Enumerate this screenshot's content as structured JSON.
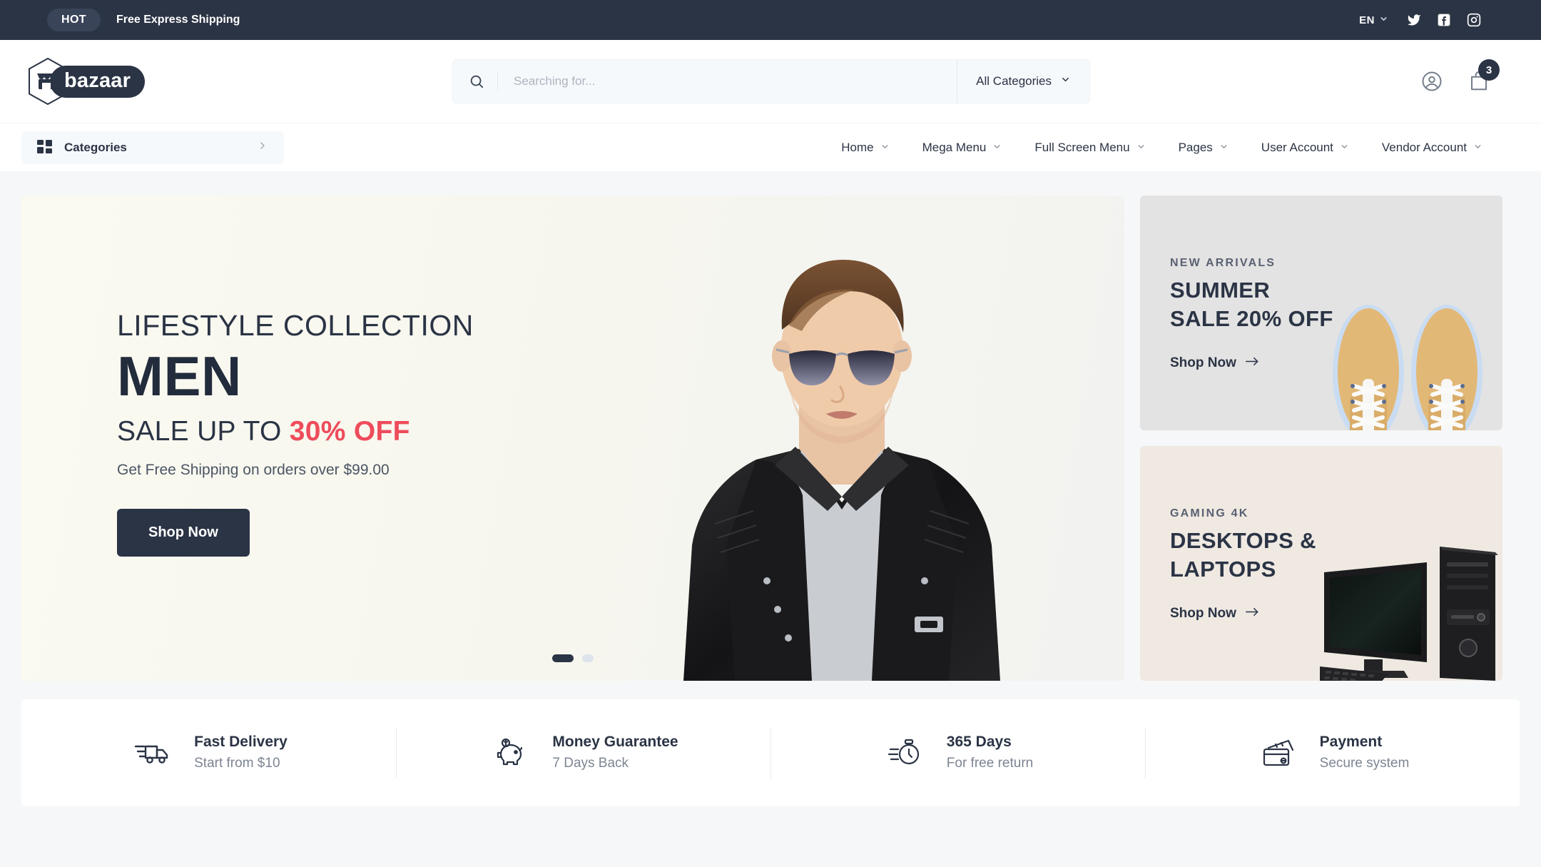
{
  "topbar": {
    "badge": "HOT",
    "message": "Free Express Shipping",
    "language": "EN",
    "social": [
      {
        "name": "twitter-icon",
        "label": "Twitter"
      },
      {
        "name": "facebook-icon",
        "label": "Facebook"
      },
      {
        "name": "instagram-icon",
        "label": "Instagram"
      }
    ]
  },
  "header": {
    "logo_text": "bazaar",
    "search": {
      "placeholder": "Searching for...",
      "value": "",
      "category": "All Categories"
    },
    "cart_count": "3"
  },
  "nav": {
    "categories_label": "Categories",
    "items": [
      {
        "label": "Home"
      },
      {
        "label": "Mega Menu"
      },
      {
        "label": "Full Screen Menu"
      },
      {
        "label": "Pages"
      },
      {
        "label": "User Account"
      },
      {
        "label": "Vendor Account"
      }
    ]
  },
  "hero": {
    "kicker": "LIFESTYLE COLLECTION",
    "title": "MEN",
    "sale_prefix": "SALE UP TO ",
    "sale_accent": "30% OFF",
    "note": "Get Free Shipping on orders over $99.00",
    "button": "Shop Now",
    "slides": [
      "1",
      "2"
    ],
    "active_slide": 0
  },
  "promos": [
    {
      "kicker": "NEW ARRIVALS",
      "title": "SUMMER\nSALE 20% OFF",
      "title_line1": "SUMMER",
      "title_line2": "SALE 20% OFF",
      "link": "Shop Now",
      "bg": "#E3E3E3"
    },
    {
      "kicker": "GAMING 4K",
      "title_line1": "DESKTOPS &",
      "title_line2": "LAPTOPS",
      "link": "Shop Now",
      "bg": "#EFE9E2"
    }
  ],
  "services": [
    {
      "icon": "truck-icon",
      "title": "Fast Delivery",
      "subtitle": "Start from $10"
    },
    {
      "icon": "piggy-bank-icon",
      "title": "Money Guarantee",
      "subtitle": "7 Days Back"
    },
    {
      "icon": "stopwatch-icon",
      "title": "365 Days",
      "subtitle": "For free return"
    },
    {
      "icon": "credit-card-icon",
      "title": "Payment",
      "subtitle": "Secure system"
    }
  ],
  "colors": {
    "dark": "#2B3445",
    "accent_red": "#EE4C5B",
    "page_bg": "#F6F7F9",
    "muted": "#7D8593"
  }
}
